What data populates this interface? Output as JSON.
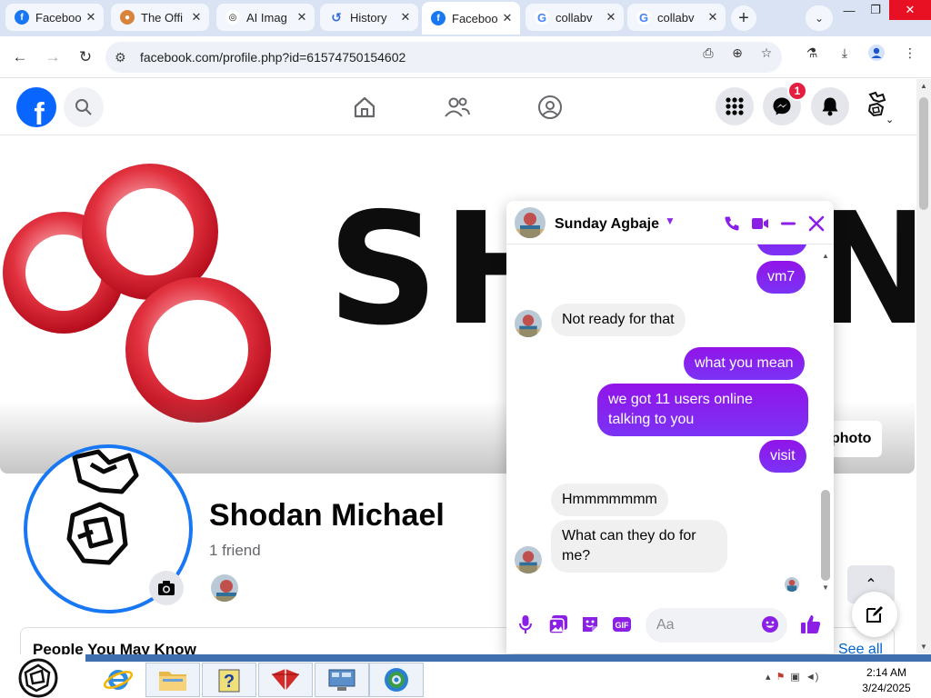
{
  "browser": {
    "tabs": [
      {
        "title": "Faceboo",
        "favicon": "facebook-icon",
        "active": false
      },
      {
        "title": "The Offi",
        "favicon": "office-icon",
        "active": false
      },
      {
        "title": "AI Imag",
        "favicon": "ai-image-icon",
        "active": false
      },
      {
        "title": "History",
        "favicon": "history-icon",
        "active": false
      },
      {
        "title": "Faceboo",
        "favicon": "facebook-icon",
        "active": true
      },
      {
        "title": "collabv",
        "favicon": "google-icon",
        "active": false
      },
      {
        "title": "collabv",
        "favicon": "google-icon",
        "active": false
      }
    ],
    "url": "facebook.com/profile.php?id=61574750154602"
  },
  "facebook": {
    "messenger_badge": "1",
    "cover_word_left": "SH",
    "cover_word_right": "N",
    "edit_cover_label": "photo",
    "profile": {
      "name": "Shodan Michael",
      "friends": "1 friend"
    },
    "people_you_may_know": "People You May Know",
    "see_all": "See all"
  },
  "chat": {
    "contact_name": "Sunday Agbaje",
    "messages": [
      {
        "from": "me",
        "text": "vm7"
      },
      {
        "from": "them",
        "text": "Not ready for that"
      },
      {
        "from": "me",
        "text": "what you mean"
      },
      {
        "from": "me",
        "text": "we got 11 users online talking to you"
      },
      {
        "from": "me",
        "text": "visit"
      },
      {
        "from": "them",
        "text": "Hmmmmmmm"
      },
      {
        "from": "them",
        "text": "What can they do for me?"
      }
    ],
    "input_placeholder": "Aa",
    "colors": {
      "accent": "#8b1fe6",
      "incoming": "#f0f0f0"
    }
  },
  "taskbar": {
    "time": "2:14 AM",
    "date": "3/24/2025"
  }
}
